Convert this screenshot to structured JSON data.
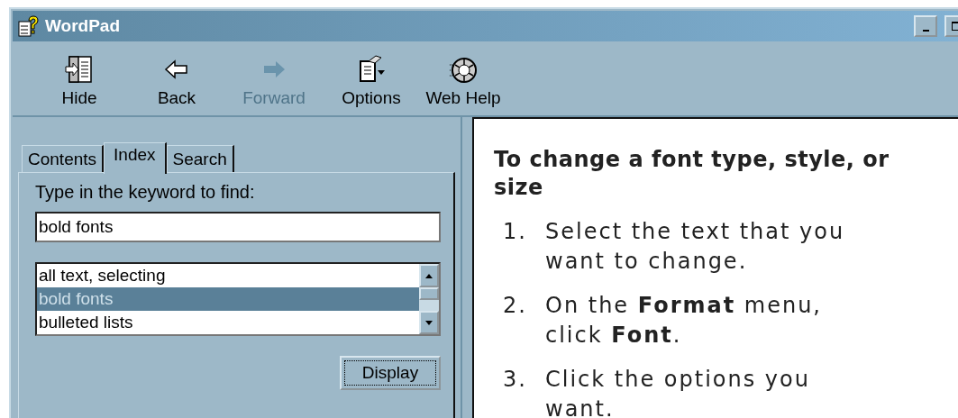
{
  "window": {
    "title": "WordPad",
    "controls": [
      {
        "kind": "minimize"
      },
      {
        "kind": "maximize"
      }
    ]
  },
  "toolbar": [
    {
      "kind": "hide",
      "label": "Hide",
      "disabled": false
    },
    {
      "kind": "back",
      "label": "Back",
      "disabled": false
    },
    {
      "kind": "forward",
      "label": "Forward",
      "disabled": true
    },
    {
      "kind": "options",
      "label": "Options",
      "disabled": false
    },
    {
      "kind": "webhelp",
      "label": "Web Help",
      "disabled": false
    }
  ],
  "tabs": [
    {
      "label": "Contents",
      "selected": false
    },
    {
      "label": "Index",
      "selected": true
    },
    {
      "label": "Search",
      "selected": false
    }
  ],
  "index": {
    "prompt": "Type in the keyword to find:",
    "keyword": "bold fonts",
    "entries": [
      {
        "text": "all text, selecting",
        "selected": false
      },
      {
        "text": "bold fonts",
        "selected": true
      },
      {
        "text": "bulleted lists",
        "selected": false
      }
    ],
    "button": {
      "label": "Display"
    }
  },
  "topic": {
    "title": "To change a font type, style, or size",
    "steps": [
      {
        "number": "1.",
        "text": "Select the text that you want to change."
      },
      {
        "number": "2.",
        "text": "On the **Format** menu, click **Font**."
      },
      {
        "number": "3.",
        "text": "Click the options you want."
      }
    ]
  }
}
